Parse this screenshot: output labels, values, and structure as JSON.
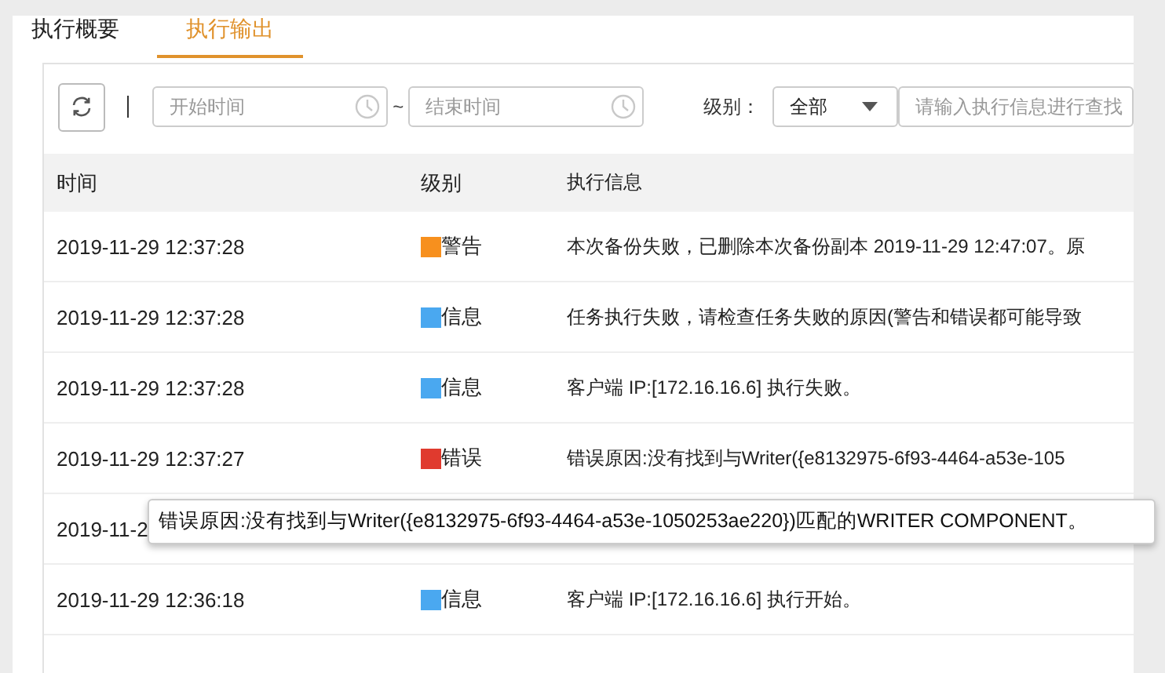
{
  "tabs": [
    {
      "label": "执行概要",
      "selected": false
    },
    {
      "label": "执行输出",
      "selected": true
    }
  ],
  "toolbar": {
    "start_time": {
      "placeholder": "开始时间"
    },
    "separator": "~",
    "end_time": {
      "placeholder": "结束时间"
    },
    "level_label": "级别：",
    "level_select": {
      "value": "全部"
    },
    "search": {
      "placeholder": "请输入执行信息进行查找"
    }
  },
  "table": {
    "columns": [
      "时间",
      "级别",
      "执行信息"
    ],
    "rows": [
      {
        "time": "2019-11-29 12:37:28",
        "level": "警告",
        "color": "#f7901e",
        "message": "本次备份失败，已删除本次备份副本 2019-11-29 12:47:07。原"
      },
      {
        "time": "2019-11-29 12:37:28",
        "level": "信息",
        "color": "#4aa8f0",
        "message": "任务执行失败，请检查任务失败的原因(警告和错误都可能导致"
      },
      {
        "time": "2019-11-29 12:37:28",
        "level": "信息",
        "color": "#4aa8f0",
        "message": "客户端 IP:[172.16.16.6] 执行失败。"
      },
      {
        "time": "2019-11-29 12:37:27",
        "level": "错误",
        "color": "#e03a2e",
        "message": "错误原因:没有找到与Writer({e8132975-6f93-4464-a53e-105"
      },
      {
        "time": "2019-11-2"
      },
      {
        "time": "2019-11-29 12:36:18",
        "level": "信息",
        "color": "#4aa8f0",
        "message": "客户端 IP:[172.16.16.6] 执行开始。"
      }
    ]
  },
  "tooltip": {
    "text": "错误原因:没有找到与Writer({e8132975-6f93-4464-a53e-1050253ae220})匹配的WRITER COMPONENT。"
  }
}
